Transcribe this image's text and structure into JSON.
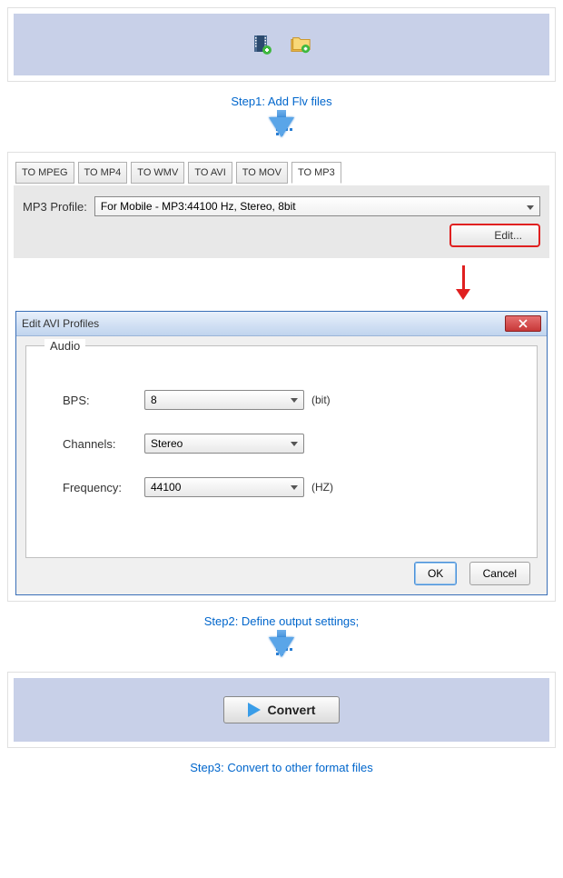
{
  "step1": {
    "caption": "Step1: Add Flv files"
  },
  "step2": {
    "tabs": [
      "TO MPEG",
      "TO MP4",
      "TO WMV",
      "TO AVI",
      "TO MOV",
      "TO MP3"
    ],
    "selected_tab_index": 5,
    "profile_label": "MP3 Profile:",
    "profile_value": "For Mobile - MP3:44100 Hz, Stereo, 8bit",
    "edit_label": "Edit...",
    "dialog": {
      "title": "Edit AVI Profiles",
      "group_label": "Audio",
      "fields": {
        "bps": {
          "label": "BPS:",
          "value": "8",
          "unit": "(bit)"
        },
        "channels": {
          "label": "Channels:",
          "value": "Stereo",
          "unit": ""
        },
        "frequency": {
          "label": "Frequency:",
          "value": "44100",
          "unit": "(HZ)"
        }
      },
      "ok": "OK",
      "cancel": "Cancel"
    },
    "caption": "Step2: Define output settings;"
  },
  "step3": {
    "convert_label": "Convert",
    "caption": "Step3: Convert to other format files"
  }
}
